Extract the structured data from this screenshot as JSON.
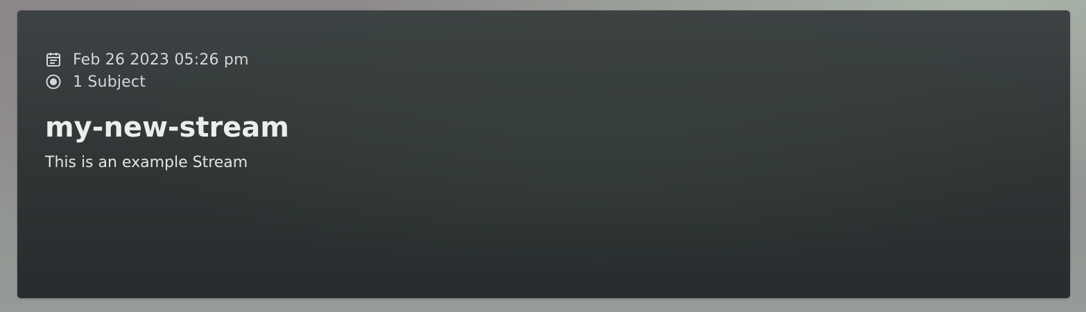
{
  "card": {
    "date": "Feb 26 2023 05:26 pm",
    "date_icon": "calendar-icon",
    "subjects": "1 Subject",
    "subjects_icon": "radio-target-icon",
    "title": "my-new-stream",
    "description": "This is an example Stream"
  },
  "colors": {
    "card_background": "#2f3535",
    "text_primary": "#eceeee",
    "text_secondary": "#d4d8d8"
  }
}
